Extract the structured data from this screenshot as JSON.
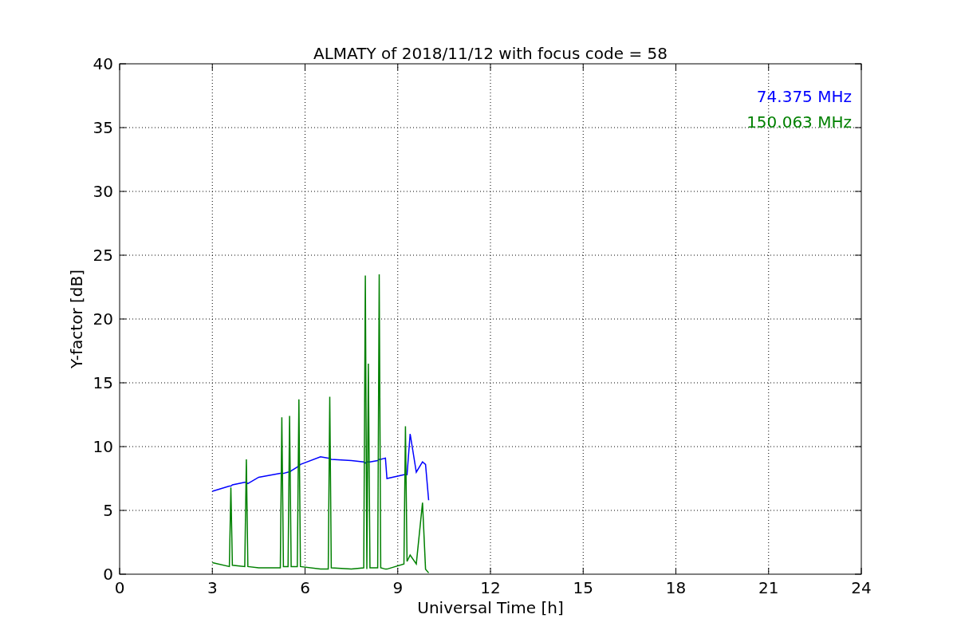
{
  "figure": {
    "chart_data": {
      "type": "line",
      "title": "ALMATY of 2018/11/12 with focus code = 58",
      "xlabel": "Universal Time [h]",
      "ylabel": "Y-factor [dB]",
      "x": [
        3,
        3.55,
        3.6,
        3.65,
        4.05,
        4.1,
        4.15,
        4.5,
        5.2,
        5.25,
        5.3,
        5.45,
        5.5,
        5.55,
        5.75,
        5.8,
        5.85,
        6.5,
        6.75,
        6.8,
        6.85,
        7.5,
        7.9,
        7.95,
        8.0,
        8.05,
        8.1,
        8.35,
        8.4,
        8.45,
        8.6,
        8.65,
        9.2,
        9.25,
        9.3,
        9.4,
        9.6,
        9.8,
        9.9,
        10
      ],
      "series": [
        {
          "name": "74.375 MHz",
          "color": "#0000ff",
          "values": [
            6.5,
            6.9,
            6.9,
            7.0,
            7.2,
            7.2,
            7.1,
            7.6,
            7.9,
            7.9,
            7.9,
            8.0,
            8.0,
            8.1,
            8.4,
            8.5,
            8.6,
            9.2,
            9.1,
            9.1,
            9.0,
            8.9,
            8.8,
            8.7,
            8.8,
            8.8,
            8.8,
            8.9,
            9.0,
            9.0,
            9.1,
            7.5,
            7.8,
            7.8,
            7.8,
            11.0,
            8.0,
            8.8,
            8.6,
            5.8
          ]
        },
        {
          "name": "150.063 MHz",
          "color": "#008000",
          "values": [
            0.9,
            0.6,
            6.8,
            0.7,
            0.6,
            9.0,
            0.6,
            0.5,
            0.5,
            12.3,
            0.6,
            0.6,
            12.4,
            0.6,
            0.6,
            13.7,
            0.6,
            0.4,
            0.4,
            13.9,
            0.5,
            0.4,
            0.5,
            23.4,
            0.4,
            16.5,
            0.5,
            0.5,
            23.5,
            0.5,
            0.4,
            0.4,
            0.8,
            11.6,
            1.0,
            1.5,
            0.8,
            5.6,
            0.4,
            0.1
          ]
        }
      ],
      "xlim": [
        0,
        24
      ],
      "ylim": [
        0,
        40
      ],
      "xticks": [
        0,
        3,
        6,
        9,
        12,
        15,
        18,
        21,
        24
      ],
      "yticks": [
        0,
        5,
        10,
        15,
        20,
        25,
        30,
        35,
        40
      ],
      "grid": true
    }
  }
}
